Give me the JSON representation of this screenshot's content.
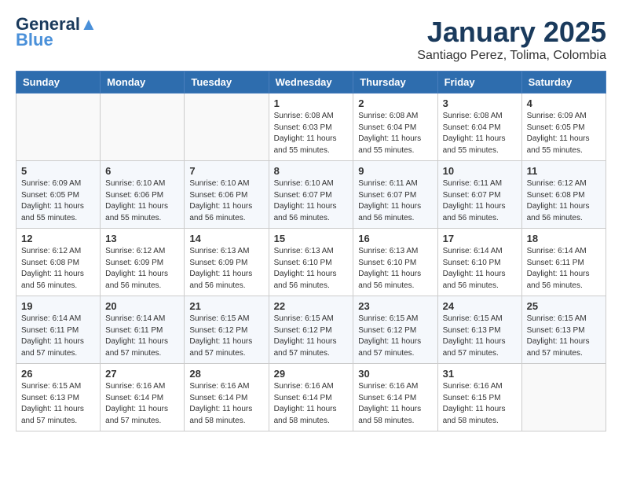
{
  "logo": {
    "text1": "General",
    "text2": "Blue"
  },
  "title": "January 2025",
  "subtitle": "Santiago Perez, Tolima, Colombia",
  "days_of_week": [
    "Sunday",
    "Monday",
    "Tuesday",
    "Wednesday",
    "Thursday",
    "Friday",
    "Saturday"
  ],
  "weeks": [
    [
      {
        "num": "",
        "info": ""
      },
      {
        "num": "",
        "info": ""
      },
      {
        "num": "",
        "info": ""
      },
      {
        "num": "1",
        "info": "Sunrise: 6:08 AM\nSunset: 6:03 PM\nDaylight: 11 hours and 55 minutes."
      },
      {
        "num": "2",
        "info": "Sunrise: 6:08 AM\nSunset: 6:04 PM\nDaylight: 11 hours and 55 minutes."
      },
      {
        "num": "3",
        "info": "Sunrise: 6:08 AM\nSunset: 6:04 PM\nDaylight: 11 hours and 55 minutes."
      },
      {
        "num": "4",
        "info": "Sunrise: 6:09 AM\nSunset: 6:05 PM\nDaylight: 11 hours and 55 minutes."
      }
    ],
    [
      {
        "num": "5",
        "info": "Sunrise: 6:09 AM\nSunset: 6:05 PM\nDaylight: 11 hours and 55 minutes."
      },
      {
        "num": "6",
        "info": "Sunrise: 6:10 AM\nSunset: 6:06 PM\nDaylight: 11 hours and 55 minutes."
      },
      {
        "num": "7",
        "info": "Sunrise: 6:10 AM\nSunset: 6:06 PM\nDaylight: 11 hours and 56 minutes."
      },
      {
        "num": "8",
        "info": "Sunrise: 6:10 AM\nSunset: 6:07 PM\nDaylight: 11 hours and 56 minutes."
      },
      {
        "num": "9",
        "info": "Sunrise: 6:11 AM\nSunset: 6:07 PM\nDaylight: 11 hours and 56 minutes."
      },
      {
        "num": "10",
        "info": "Sunrise: 6:11 AM\nSunset: 6:07 PM\nDaylight: 11 hours and 56 minutes."
      },
      {
        "num": "11",
        "info": "Sunrise: 6:12 AM\nSunset: 6:08 PM\nDaylight: 11 hours and 56 minutes."
      }
    ],
    [
      {
        "num": "12",
        "info": "Sunrise: 6:12 AM\nSunset: 6:08 PM\nDaylight: 11 hours and 56 minutes."
      },
      {
        "num": "13",
        "info": "Sunrise: 6:12 AM\nSunset: 6:09 PM\nDaylight: 11 hours and 56 minutes."
      },
      {
        "num": "14",
        "info": "Sunrise: 6:13 AM\nSunset: 6:09 PM\nDaylight: 11 hours and 56 minutes."
      },
      {
        "num": "15",
        "info": "Sunrise: 6:13 AM\nSunset: 6:10 PM\nDaylight: 11 hours and 56 minutes."
      },
      {
        "num": "16",
        "info": "Sunrise: 6:13 AM\nSunset: 6:10 PM\nDaylight: 11 hours and 56 minutes."
      },
      {
        "num": "17",
        "info": "Sunrise: 6:14 AM\nSunset: 6:10 PM\nDaylight: 11 hours and 56 minutes."
      },
      {
        "num": "18",
        "info": "Sunrise: 6:14 AM\nSunset: 6:11 PM\nDaylight: 11 hours and 56 minutes."
      }
    ],
    [
      {
        "num": "19",
        "info": "Sunrise: 6:14 AM\nSunset: 6:11 PM\nDaylight: 11 hours and 57 minutes."
      },
      {
        "num": "20",
        "info": "Sunrise: 6:14 AM\nSunset: 6:11 PM\nDaylight: 11 hours and 57 minutes."
      },
      {
        "num": "21",
        "info": "Sunrise: 6:15 AM\nSunset: 6:12 PM\nDaylight: 11 hours and 57 minutes."
      },
      {
        "num": "22",
        "info": "Sunrise: 6:15 AM\nSunset: 6:12 PM\nDaylight: 11 hours and 57 minutes."
      },
      {
        "num": "23",
        "info": "Sunrise: 6:15 AM\nSunset: 6:12 PM\nDaylight: 11 hours and 57 minutes."
      },
      {
        "num": "24",
        "info": "Sunrise: 6:15 AM\nSunset: 6:13 PM\nDaylight: 11 hours and 57 minutes."
      },
      {
        "num": "25",
        "info": "Sunrise: 6:15 AM\nSunset: 6:13 PM\nDaylight: 11 hours and 57 minutes."
      }
    ],
    [
      {
        "num": "26",
        "info": "Sunrise: 6:15 AM\nSunset: 6:13 PM\nDaylight: 11 hours and 57 minutes."
      },
      {
        "num": "27",
        "info": "Sunrise: 6:16 AM\nSunset: 6:14 PM\nDaylight: 11 hours and 57 minutes."
      },
      {
        "num": "28",
        "info": "Sunrise: 6:16 AM\nSunset: 6:14 PM\nDaylight: 11 hours and 58 minutes."
      },
      {
        "num": "29",
        "info": "Sunrise: 6:16 AM\nSunset: 6:14 PM\nDaylight: 11 hours and 58 minutes."
      },
      {
        "num": "30",
        "info": "Sunrise: 6:16 AM\nSunset: 6:14 PM\nDaylight: 11 hours and 58 minutes."
      },
      {
        "num": "31",
        "info": "Sunrise: 6:16 AM\nSunset: 6:15 PM\nDaylight: 11 hours and 58 minutes."
      },
      {
        "num": "",
        "info": ""
      }
    ]
  ]
}
